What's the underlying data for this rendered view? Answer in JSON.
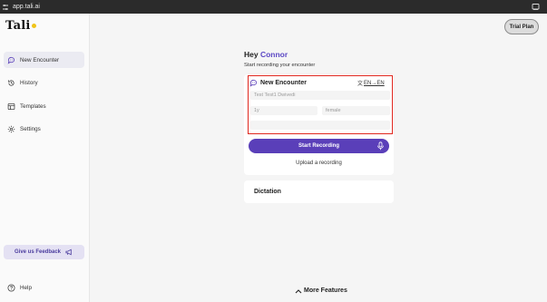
{
  "browser": {
    "url": "app.tali.ai",
    "site_icon": "site-settings-icon",
    "cast_icon": "cast-icon"
  },
  "sidebar": {
    "logo": "Tali",
    "items": [
      {
        "label": "New Encounter",
        "icon": "chat-bubble-icon",
        "active": true
      },
      {
        "label": "History",
        "icon": "history-icon"
      },
      {
        "label": "Templates",
        "icon": "templates-icon"
      },
      {
        "label": "Settings",
        "icon": "gear-icon"
      }
    ],
    "feedback_label": "Give us Feedback",
    "feedback_icon": "megaphone-icon",
    "help_label": "Help",
    "help_icon": "help-icon"
  },
  "header": {
    "trial_label": "Trial Plan"
  },
  "main": {
    "greeting_prefix": "Hey",
    "user_name": "Connor",
    "subtitle": "Start recording your encounter",
    "encounter": {
      "title": "New Encounter",
      "language": "EN→EN",
      "patient_name": "Test Test1 Dwivedi",
      "age": "1y",
      "gender": "female",
      "extra": ""
    },
    "start_recording_label": "Start Recording",
    "upload_label": "Upload a recording",
    "dictation_label": "Dictation",
    "more_features_label": "More Features"
  },
  "colors": {
    "accent": "#5a3fb9",
    "name_highlight": "#5b47c4",
    "feedback_bg": "#e4e1f3",
    "highlight_border": "#e0281f"
  }
}
